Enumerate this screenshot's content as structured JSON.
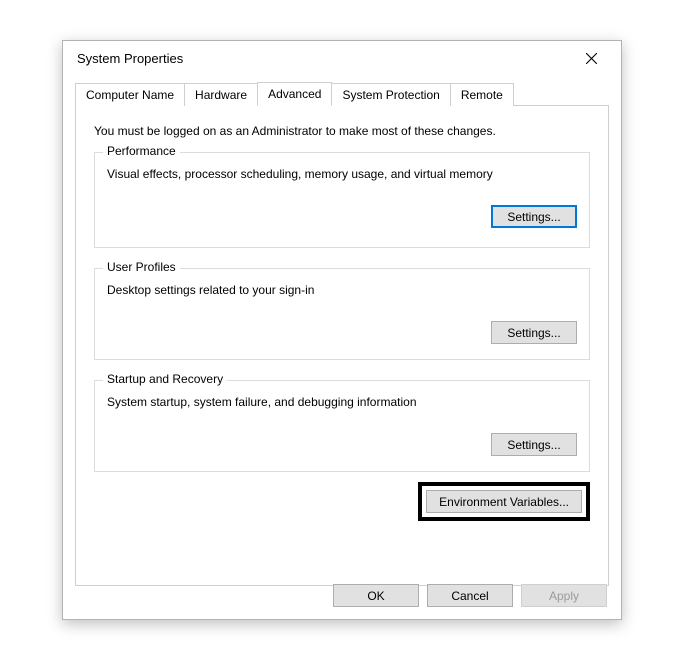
{
  "window": {
    "title": "System Properties"
  },
  "tabs": {
    "computer_name": "Computer Name",
    "hardware": "Hardware",
    "advanced": "Advanced",
    "system_protection": "System Protection",
    "remote": "Remote"
  },
  "advanced": {
    "intro": "You must be logged on as an Administrator to make most of these changes.",
    "performance": {
      "legend": "Performance",
      "text": "Visual effects, processor scheduling, memory usage, and virtual memory",
      "settings_btn": "Settings..."
    },
    "user_profiles": {
      "legend": "User Profiles",
      "text": "Desktop settings related to your sign-in",
      "settings_btn": "Settings..."
    },
    "startup_recovery": {
      "legend": "Startup and Recovery",
      "text": "System startup, system failure, and debugging information",
      "settings_btn": "Settings..."
    },
    "env_vars_btn": "Environment Variables..."
  },
  "buttons": {
    "ok": "OK",
    "cancel": "Cancel",
    "apply": "Apply"
  }
}
